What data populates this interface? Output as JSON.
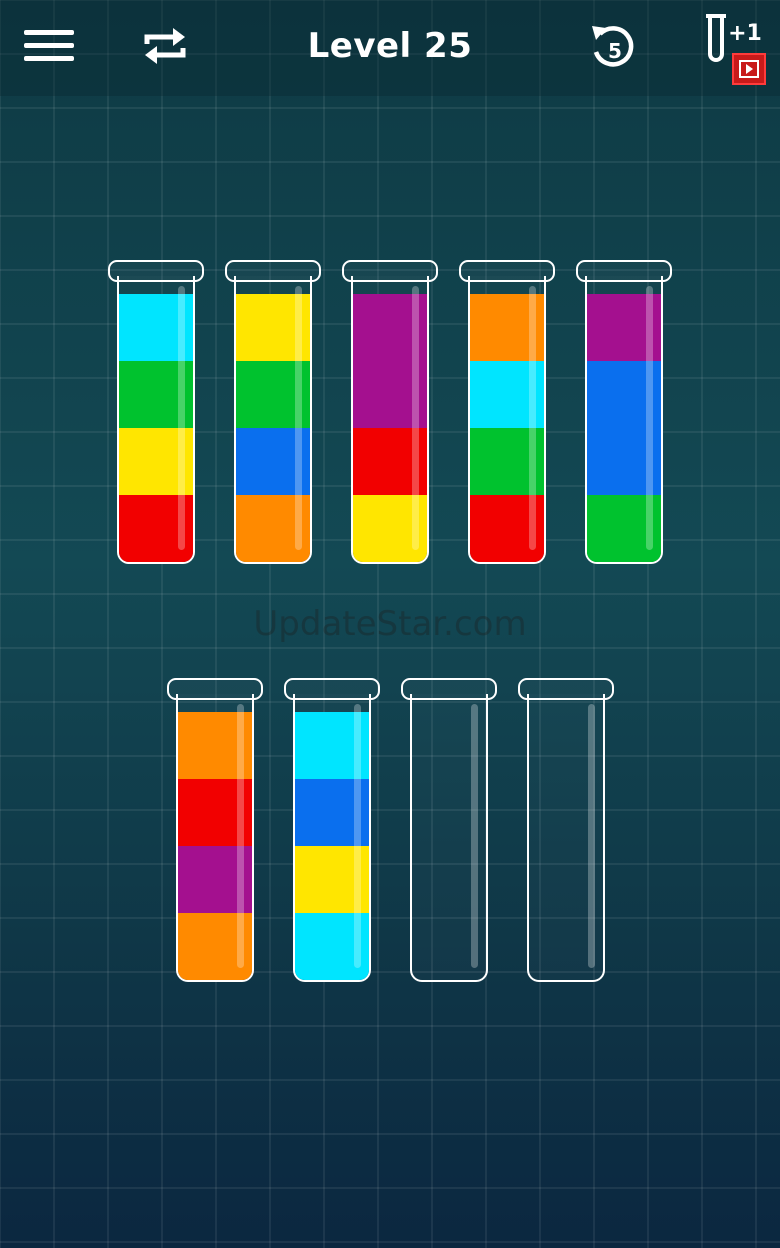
{
  "header": {
    "level_title": "Level 25",
    "undo_count": "5",
    "add_tube_label": "+1"
  },
  "watermark": "UpdateStar.com",
  "colors": {
    "cyan": "#00e5ff",
    "green": "#00c22e",
    "yellow": "#ffe600",
    "red": "#f20000",
    "orange": "#ff8a00",
    "blue": "#0a6fee",
    "purple": "#a4108f",
    "ad_badge": "#c81a1a"
  },
  "tubes": [
    {
      "layers": [
        "red",
        "yellow",
        "green",
        "cyan"
      ]
    },
    {
      "layers": [
        "orange",
        "blue",
        "green",
        "yellow"
      ]
    },
    {
      "layers": [
        "yellow",
        "red",
        "purple",
        "purple"
      ]
    },
    {
      "layers": [
        "red",
        "green",
        "cyan",
        "orange"
      ]
    },
    {
      "layers": [
        "green",
        "blue",
        "blue",
        "purple"
      ]
    },
    {
      "layers": [
        "orange",
        "purple",
        "red",
        "orange"
      ]
    },
    {
      "layers": [
        "cyan",
        "yellow",
        "blue",
        "cyan"
      ]
    },
    {
      "layers": []
    },
    {
      "layers": []
    }
  ]
}
